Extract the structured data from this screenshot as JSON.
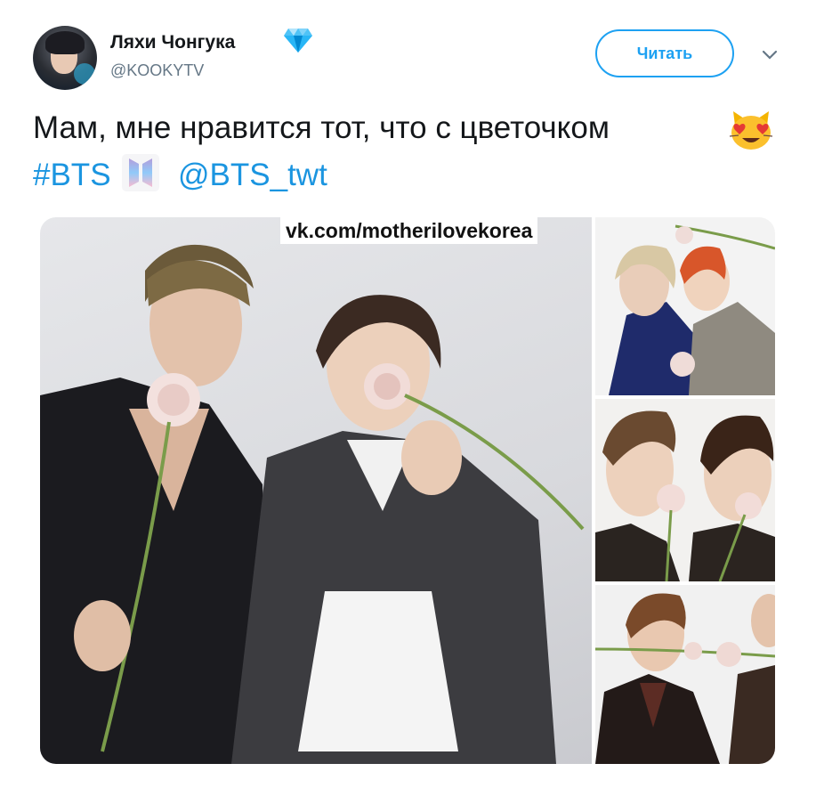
{
  "author": {
    "name": "Ляхи Чонгука",
    "handle": "@KOOKYTV",
    "verified_icon": "diamond-icon"
  },
  "actions": {
    "follow_label": "Читать",
    "menu_icon": "chevron-down-icon"
  },
  "tweet": {
    "text": "Мам, мне нравится тот, что с цветочком",
    "emoji": "heart-eyes-cat-emoji",
    "hashtag": "#BTS",
    "hashtag_icon": "bts-logo-icon",
    "mention": "@BTS_twt"
  },
  "media": {
    "watermark": "vk.com/motherilovekorea",
    "photo_count": 4
  },
  "colors": {
    "accent": "#1da1f2",
    "link": "#1b95e0",
    "text": "#14171a",
    "muted": "#657786"
  }
}
